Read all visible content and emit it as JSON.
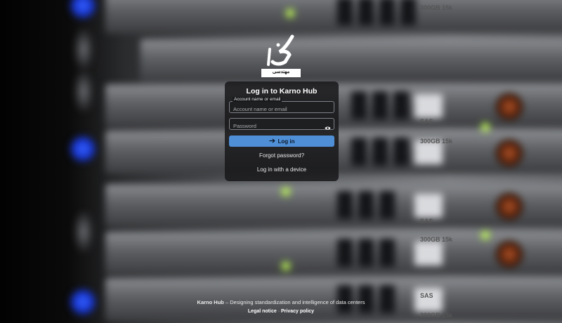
{
  "logo": {
    "icon": "karno-logo-icon",
    "text": "مهندسی",
    "mark": "کانو"
  },
  "login": {
    "title": "Log in to Karno Hub",
    "username": {
      "label": "Account name or email",
      "placeholder": "Account name or email",
      "value": ""
    },
    "password": {
      "placeholder": "Password",
      "value": "",
      "toggle_icon": "eye-icon"
    },
    "submit_label": "Log in",
    "submit_icon": "arrow-right-icon",
    "forgot_label": "Forgot password?",
    "device_label": "Log in with a device",
    "accent_color": "#4f8fd6"
  },
  "background": {
    "hdd_labels": [
      "300GB 15k",
      "SAS",
      "300GB 15k",
      "SAS",
      "300GB 15k",
      "SAS",
      "300GB 15k"
    ]
  },
  "footer": {
    "brand": "Karno Hub",
    "separator": " – ",
    "tagline": "Designing standardization and intelligence of data centers",
    "links": [
      {
        "label": "Legal notice"
      },
      {
        "label": "Privacy policy"
      }
    ],
    "link_separator": " · "
  }
}
